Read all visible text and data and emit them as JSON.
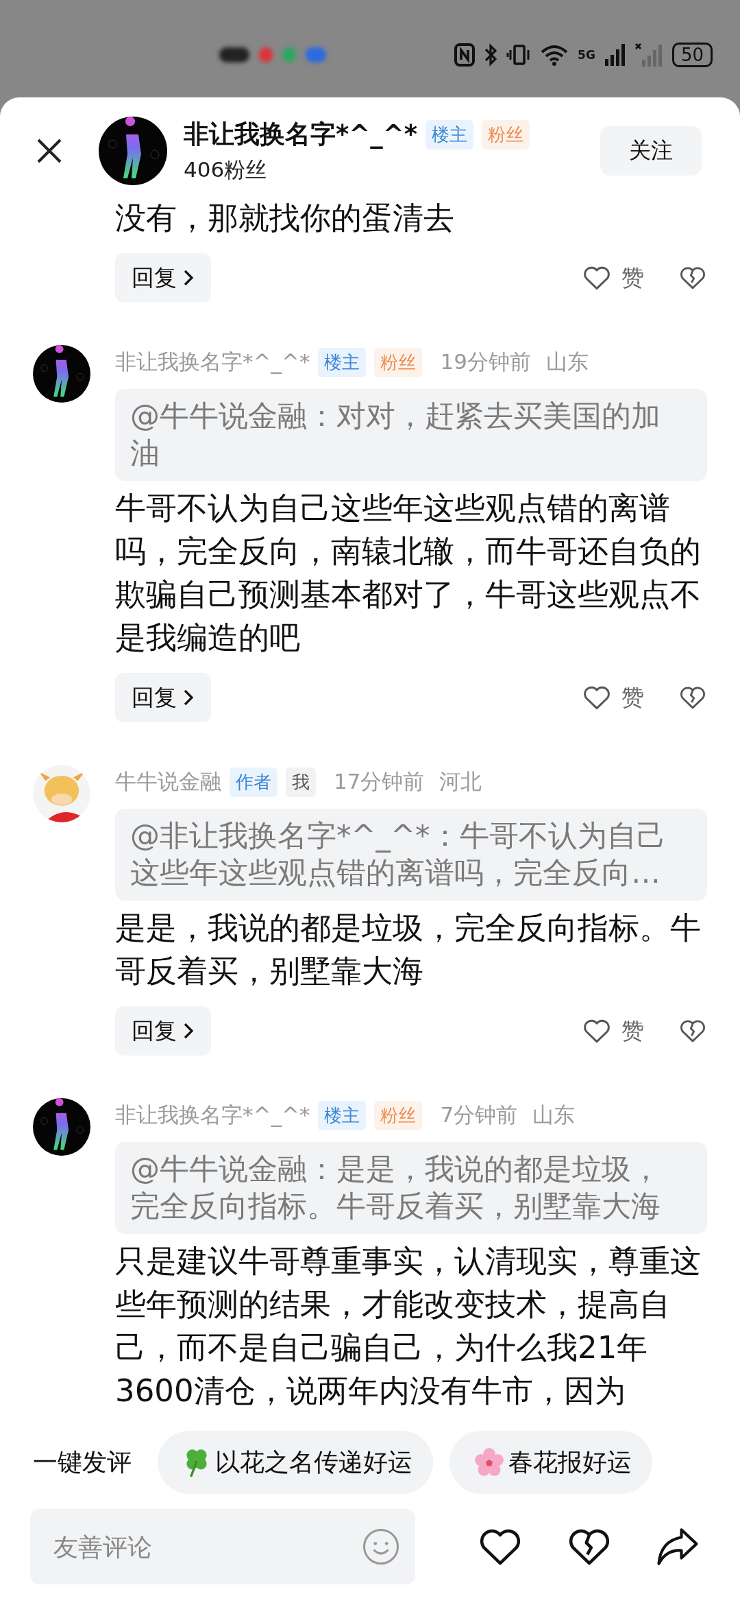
{
  "status_bar": {
    "network": "5G",
    "battery": "50"
  },
  "header": {
    "name": "非让我换名字*^_^*",
    "badges": [
      {
        "kind": "host",
        "label": "楼主"
      },
      {
        "kind": "fan",
        "label": "粉丝"
      }
    ],
    "followers": "406粉丝",
    "follow_button": "关注"
  },
  "main_comment": {
    "text": "没有，那就找你的蛋清去",
    "reply": "回复",
    "like": "赞"
  },
  "comments": [
    {
      "kind": "couple",
      "name": "非让我换名字*^_^*",
      "badges": [
        {
          "kind": "host",
          "label": "楼主"
        },
        {
          "kind": "fan",
          "label": "粉丝"
        }
      ],
      "time": "19分钟前",
      "location": "山东",
      "quote": "@牛牛说金融：对对，赶紧去买美国的加油",
      "text": "牛哥不认为自己这些年这些观点错的离谱吗，完全反向，南辕北辙，而牛哥还自负的欺骗自己预测基本都对了，牛哥这些观点不是我编造的吧",
      "reply": "回复",
      "like": "赞"
    },
    {
      "kind": "cow",
      "name": "牛牛说金融",
      "badges": [
        {
          "kind": "author",
          "label": "作者"
        },
        {
          "kind": "me",
          "label": "我"
        }
      ],
      "time": "17分钟前",
      "location": "河北",
      "quote": "@非让我换名字*^_^*：牛哥不认为自己这些年这些观点错的离谱吗，完全反向…",
      "text": "是是，我说的都是垃圾，完全反向指标。牛哥反着买，别墅靠大海",
      "reply": "回复",
      "like": "赞"
    },
    {
      "kind": "couple",
      "name": "非让我换名字*^_^*",
      "badges": [
        {
          "kind": "host",
          "label": "楼主"
        },
        {
          "kind": "fan",
          "label": "粉丝"
        }
      ],
      "time": "7分钟前",
      "location": "山东",
      "quote": "@牛牛说金融：是是，我说的都是垃圾，完全反向指标。牛哥反着买，别墅靠大海",
      "text": "只是建议牛哥尊重事实，认清现实，尊重这些年预测的结果，才能改变技术，提高自己，而不是自己骗自己，为什么我21年3600清仓，说两年内没有牛市，因为"
    }
  ],
  "quick_comments": {
    "label": "一键发评",
    "chips": [
      {
        "kind": "clover",
        "label": "以花之名传递好运"
      },
      {
        "kind": "blossom",
        "label": "春花报好运"
      }
    ]
  },
  "composer": {
    "placeholder": "友善评论"
  }
}
